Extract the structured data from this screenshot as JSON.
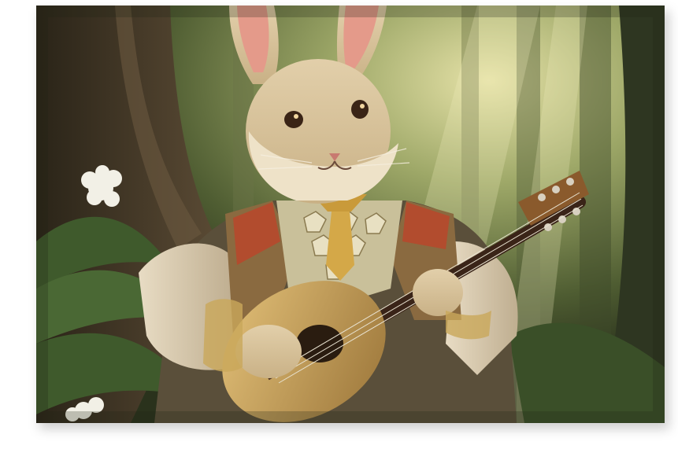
{
  "artwork": {
    "subject": "rabbit-bard-playing-lute",
    "setting": "forest",
    "colors": {
      "forest_light": "#c9c68a",
      "forest_dark": "#2d3520",
      "fur": "#d8c4a0",
      "ear_inner": "#e49a8a",
      "lute_body": "#c8a45a",
      "vest_accent": "#b8462c"
    }
  }
}
